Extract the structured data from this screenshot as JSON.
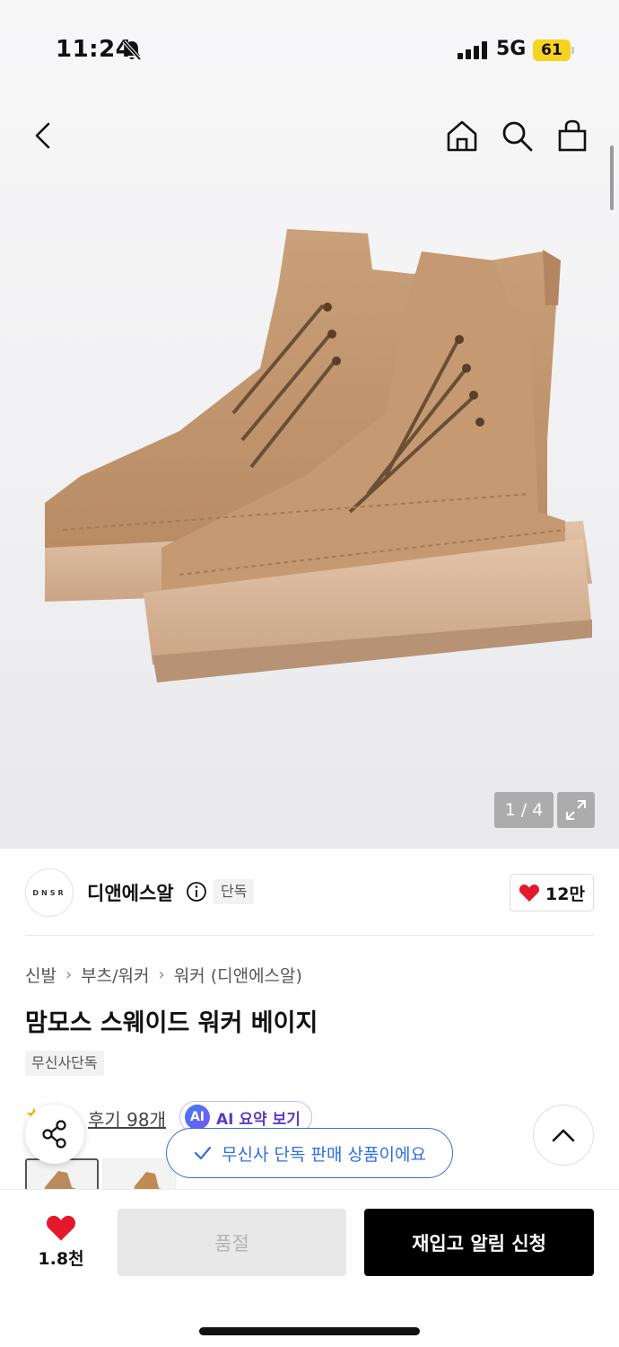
{
  "status_bar": {
    "time": "11:24",
    "network": "5G",
    "battery": "61"
  },
  "gallery": {
    "counter": "1 / 4"
  },
  "brand": {
    "logo_text": "DNSR",
    "name": "디앤에스알",
    "tag": "단독",
    "like_count": "12만"
  },
  "breadcrumb": [
    "신발",
    "부츠/워커",
    "워커 (디앤에스알)"
  ],
  "product": {
    "title": "맘모스 스웨이드 워커 베이지",
    "tag": "무신사단독"
  },
  "reviews": {
    "link": "후기 98개",
    "ai_summary": "AI 요약 보기",
    "ai_badge": "AI"
  },
  "toast": {
    "message": "무신사 단독 판매 상품이에요"
  },
  "bottom_bar": {
    "wish_count": "1.8천",
    "soldout_label": "품절",
    "restock_label": "재입고 알림 신청"
  },
  "colors": {
    "accent_blue": "#2f6fe0",
    "heart_red": "#e5192c",
    "ai_purple": "#5a3cc4",
    "battery_yellow": "#f5d31f"
  }
}
